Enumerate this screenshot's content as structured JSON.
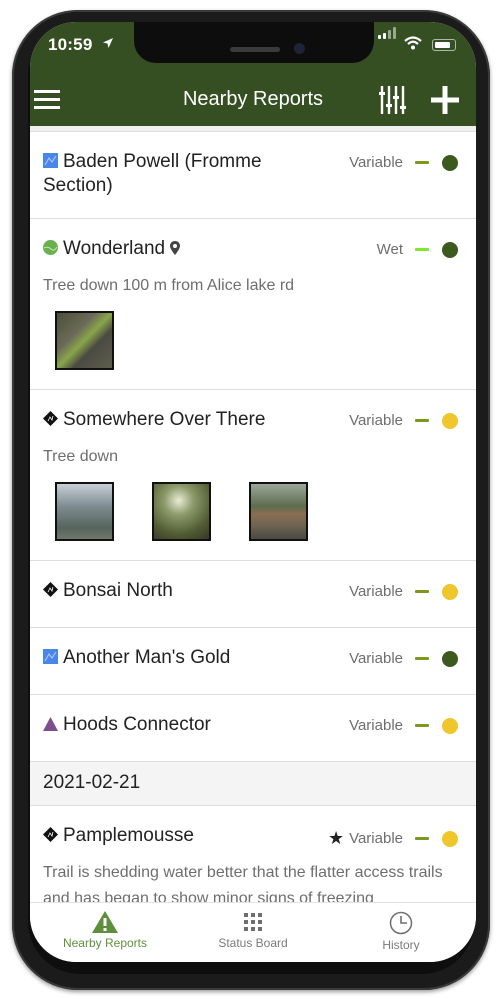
{
  "status_bar": {
    "time": "10:59"
  },
  "nav": {
    "title": "Nearby Reports",
    "menu_icon": "hamburger-icon",
    "filter_icon": "sliders-icon",
    "add_icon": "plus-icon"
  },
  "colors": {
    "header": "#364f22",
    "dark_green": "#3c5a1e",
    "yellow": "#efc62b",
    "olive_dash": "#7b9a1c",
    "lime_dash": "#7bea2b",
    "active_tab": "#5f8f3c",
    "inactive_tab": "#7a7a7a"
  },
  "reports": [
    {
      "name": "Baden Powell (Fromme Section)",
      "trail_icon": "blue-square-icon",
      "condition": "Variable",
      "trend": "olive",
      "status": "dark-green"
    },
    {
      "name": "Wonderland",
      "trail_icon": "green-circle-icon",
      "has_pin": true,
      "condition": "Wet",
      "trend": "lime",
      "status": "dark-green",
      "description": "Tree down 100 m from Alice lake rd",
      "photos": 1
    },
    {
      "name": "Somewhere Over There",
      "trail_icon": "black-diamond-icon",
      "condition": "Variable",
      "trend": "olive",
      "status": "yellow",
      "description": "Tree down",
      "photos": 3
    },
    {
      "name": "Bonsai North",
      "trail_icon": "black-diamond-icon",
      "condition": "Variable",
      "trend": "olive",
      "status": "yellow"
    },
    {
      "name": "Another Man's Gold",
      "trail_icon": "blue-square-icon",
      "condition": "Variable",
      "trend": "olive",
      "status": "dark-green"
    },
    {
      "name": "Hoods Connector",
      "trail_icon": "purple-triangle-icon",
      "condition": "Variable",
      "trend": "olive",
      "status": "yellow"
    }
  ],
  "date_section": {
    "date": "2021-02-21"
  },
  "dated_reports": [
    {
      "name": "Pamplemousse",
      "trail_icon": "black-diamond-icon",
      "starred": true,
      "star": "★",
      "condition": "Variable",
      "trend": "olive",
      "status": "yellow",
      "description": "Trail is shedding water better that the flatter access trails and has began to show minor signs of freezing"
    }
  ],
  "tabs": [
    {
      "label": "Nearby Reports",
      "icon": "warning-triangle-icon",
      "active": true
    },
    {
      "label": "Status Board",
      "icon": "grid-dots-icon",
      "active": false
    },
    {
      "label": "History",
      "icon": "clock-icon",
      "active": false
    }
  ]
}
